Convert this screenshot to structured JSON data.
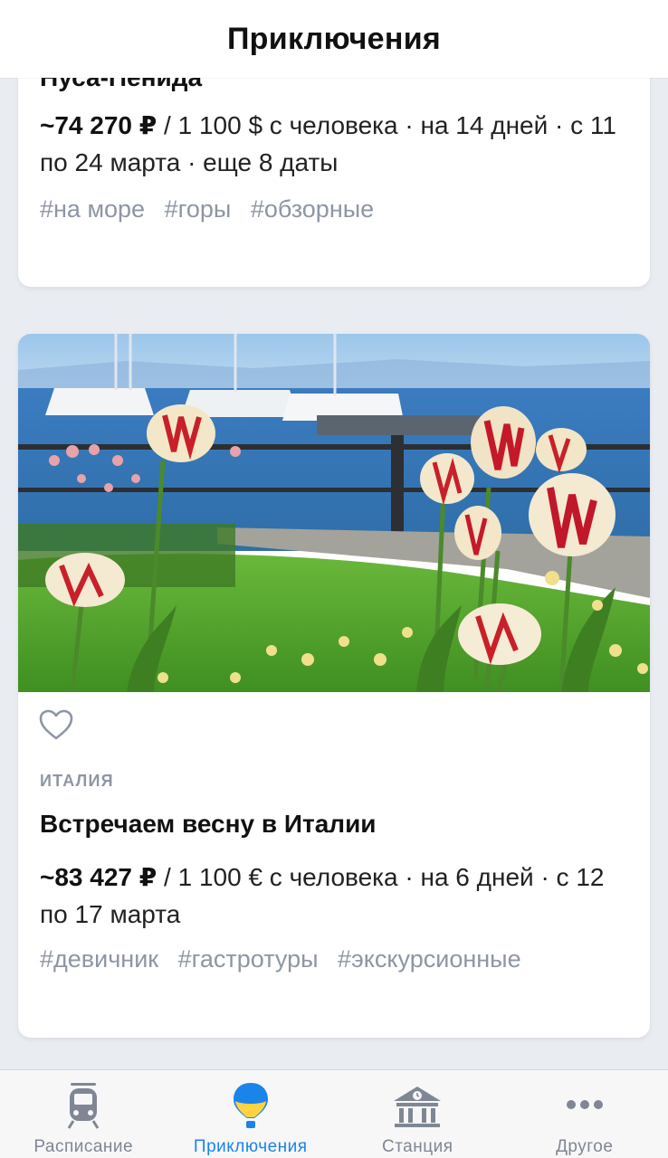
{
  "header": {
    "title": "Приключения"
  },
  "cards": [
    {
      "title": "Нуса-Пенида",
      "price_main": "~74 270 ₽",
      "price_rest": " / 1 100 $ с человека · на 14 дней · с 11 по 24 марта · еще 8 даты",
      "tags": [
        "#на море",
        "#горы",
        "#обзорные"
      ]
    },
    {
      "country": "ИТАЛИЯ",
      "title": "Встречаем весну в Италии",
      "price_main": "~83 427 ₽",
      "price_rest": " / 1 100 € с человека · на 6 дней · с 12 по 17 марта",
      "tags": [
        "#девичник",
        "#гастротуры",
        "#экскурсионные"
      ],
      "favorite_icon": "heart-outline-icon"
    }
  ],
  "tabbar": {
    "items": [
      {
        "label": "Расписание",
        "icon": "train-icon",
        "active": false
      },
      {
        "label": "Приключения",
        "icon": "balloon-icon",
        "active": true
      },
      {
        "label": "Станция",
        "icon": "station-icon",
        "active": false
      },
      {
        "label": "Другое",
        "icon": "more-icon",
        "active": false
      }
    ],
    "active_color": "#1a84ea",
    "inactive_color": "#7f8794"
  }
}
